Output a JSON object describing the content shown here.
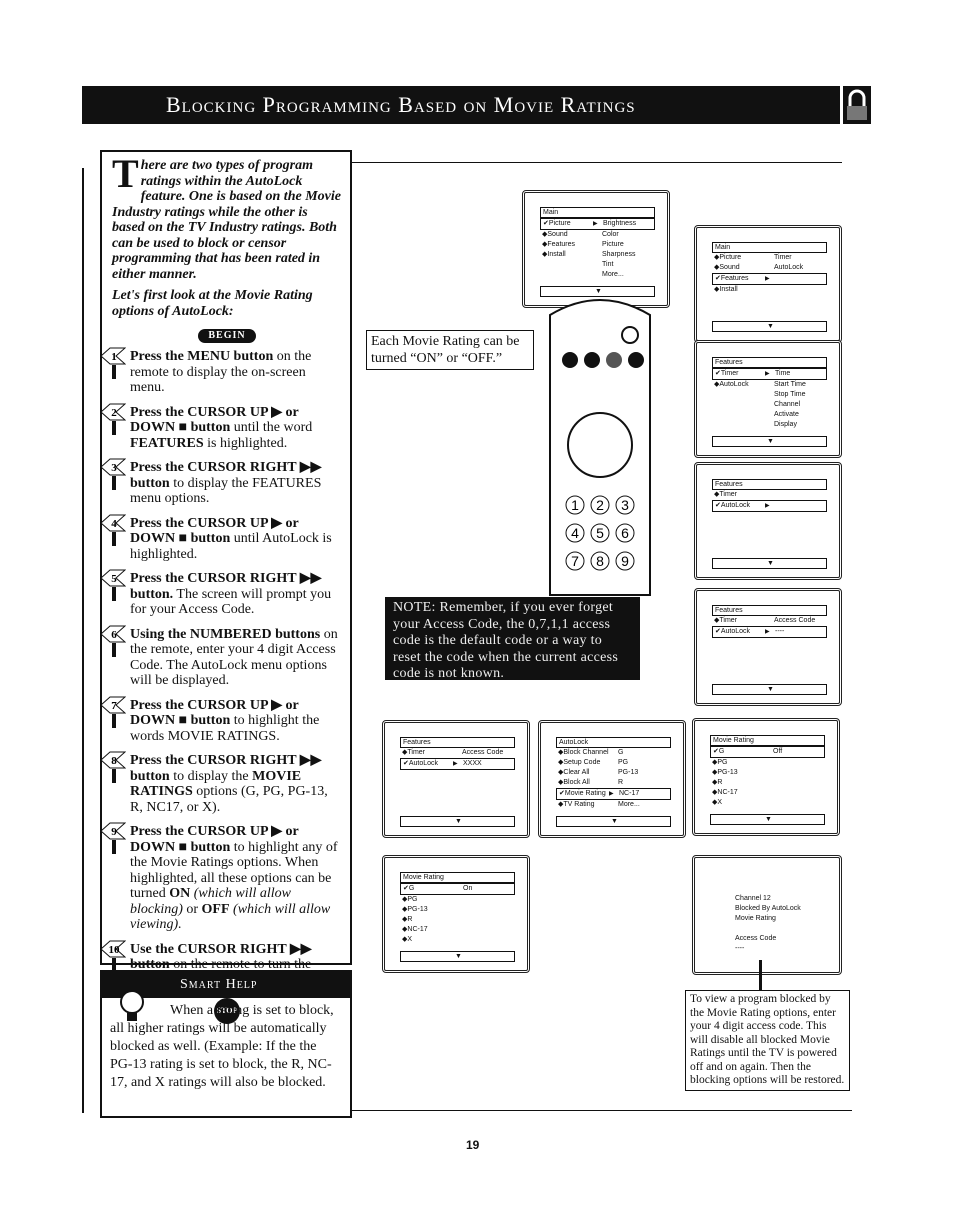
{
  "title": "Blocking Programming Based on Movie Ratings",
  "intro": {
    "dropcap": "T",
    "text": "here are two types of program ratings within the AutoLock feature. One is based on the Movie Industry ratings while the other is based on the TV Industry ratings. Both can be used to block or censor programming that has been rated in either manner.",
    "sub": "Let's first look at the Movie Rating options of AutoLock:"
  },
  "begin_label": "BEGIN",
  "steps": [
    {
      "n": "1",
      "parts": [
        {
          "b": "Press the MENU button"
        },
        {
          "t": " on the remote to display the on-screen menu."
        }
      ]
    },
    {
      "n": "2",
      "parts": [
        {
          "b": "Press the CURSOR UP ▶ or DOWN ■ button"
        },
        {
          "t": " until the word "
        },
        {
          "b": "FEATURES"
        },
        {
          "t": " is highlighted."
        }
      ]
    },
    {
      "n": "3",
      "parts": [
        {
          "b": "Press the CURSOR RIGHT ▶▶ button"
        },
        {
          "t": " to display the FEATURES menu options."
        }
      ]
    },
    {
      "n": "4",
      "parts": [
        {
          "b": "Press the CURSOR UP ▶ or DOWN ■ button"
        },
        {
          "t": " until AutoLock is highlighted."
        }
      ]
    },
    {
      "n": "5",
      "parts": [
        {
          "b": "Press the CURSOR RIGHT ▶▶ button."
        },
        {
          "t": " The screen will prompt you for your Access Code."
        }
      ]
    },
    {
      "n": "6",
      "parts": [
        {
          "b": "Using the NUMBERED buttons"
        },
        {
          "t": " on the remote, enter your 4 digit Access Code. The AutoLock menu options will be displayed."
        }
      ]
    },
    {
      "n": "7",
      "parts": [
        {
          "b": "Press the CURSOR UP ▶ or DOWN ■ button"
        },
        {
          "t": " to highlight the words MOVIE RATINGS."
        }
      ]
    },
    {
      "n": "8",
      "parts": [
        {
          "b": "Press the CURSOR RIGHT ▶▶ button"
        },
        {
          "t": " to display the "
        },
        {
          "b": "MOVIE RATINGS"
        },
        {
          "t": " options (G, PG, PG-13, R, NC17, or X)."
        }
      ]
    },
    {
      "n": "9",
      "parts": [
        {
          "b": "Press the CURSOR UP ▶ or DOWN ■ button"
        },
        {
          "t": " to highlight any of the Movie Ratings options. When highlighted, all these options can be turned "
        },
        {
          "b": "ON"
        },
        {
          "i": " (which will allow blocking)"
        },
        {
          "t": " or "
        },
        {
          "b": "OFF"
        },
        {
          "i": " (which will allow viewing)."
        }
      ]
    },
    {
      "n": "10",
      "parts": [
        {
          "b": "Use the CURSOR RIGHT ▶▶ button"
        },
        {
          "t": " on the remote to turn the rating option ON or OFF."
        }
      ]
    }
  ],
  "stop_label": "STOP",
  "smart_help": {
    "title": "Smart Help",
    "text": "When a rating is set to block, all higher ratings will be automatically blocked as well. (Example: If the the PG-13 rating is set to block, the R, NC-17, and X ratings will also be blocked."
  },
  "callout_rating": "Each Movie Rating can be turned “ON” or “OFF.”",
  "note": "NOTE: Remember, if you ever forget your Access Code, the 0,7,1,1 access code is the default code or a way to reset the code when the current access code is not known.",
  "callout_blocked": "To view a program blocked by the Movie Rating options, enter your 4 digit access code. This will disable all blocked Movie Ratings until the TV is powered off and on again. Then the blocking options will be restored.",
  "page_number": "19",
  "screens": [
    {
      "header": "Main",
      "rows": [
        {
          "l": "✔Picture",
          "r": "Brightness",
          "sel": true,
          "arrow": true
        },
        {
          "l": "◆Sound",
          "r": "Color"
        },
        {
          "l": "◆Features",
          "r": "Picture"
        },
        {
          "l": "◆Install",
          "r": "Sharpness"
        },
        {
          "l": "",
          "r": "Tint"
        },
        {
          "l": "",
          "r": "More..."
        }
      ]
    },
    {
      "header": "Main",
      "rows": [
        {
          "l": "◆Picture",
          "r": "Timer"
        },
        {
          "l": "◆Sound",
          "r": "AutoLock"
        },
        {
          "l": "✔Features",
          "sel": true,
          "arrow": true
        },
        {
          "l": "◆Install"
        }
      ]
    },
    {
      "header": "Features",
      "rows": [
        {
          "l": "✔Timer",
          "r": "Time",
          "sel": true,
          "arrow": true
        },
        {
          "l": "◆AutoLock",
          "r": "Start Time"
        },
        {
          "l": "",
          "r": "Stop Time"
        },
        {
          "l": "",
          "r": "Channel"
        },
        {
          "l": "",
          "r": "Activate"
        },
        {
          "l": "",
          "r": "Display"
        }
      ]
    },
    {
      "header": "Features",
      "rows": [
        {
          "l": "◆Timer"
        },
        {
          "l": "✔AutoLock",
          "sel": true,
          "arrow": true
        }
      ]
    },
    {
      "header": "Features",
      "rows": [
        {
          "l": "◆Timer",
          "r": "Access Code"
        },
        {
          "l": "✔AutoLock",
          "r": "----",
          "sel": true,
          "arrow": true
        }
      ]
    },
    {
      "header": "Features",
      "rows": [
        {
          "l": "◆Timer",
          "r": "Access Code"
        },
        {
          "l": "✔AutoLock",
          "r": "XXXX",
          "sel": true,
          "arrow": true
        }
      ]
    },
    {
      "header": "AutoLock",
      "rows": [
        {
          "l": "◆Block Channel",
          "r": "G"
        },
        {
          "l": "◆Setup Code",
          "r": "PG"
        },
        {
          "l": "◆Clear All",
          "r": "PG-13"
        },
        {
          "l": "◆Block All",
          "r": "R"
        },
        {
          "l": "✔Movie Rating",
          "r": "NC-17",
          "sel": true,
          "arrow": true
        },
        {
          "l": "◆TV Rating",
          "r": "More..."
        }
      ]
    },
    {
      "header": "Movie Rating",
      "rows": [
        {
          "l": "✔G",
          "r": "Off",
          "sel": true
        },
        {
          "l": "◆PG"
        },
        {
          "l": "◆PG-13"
        },
        {
          "l": "◆R"
        },
        {
          "l": "◆NC-17"
        },
        {
          "l": "◆X"
        }
      ]
    },
    {
      "header": "Movie Rating",
      "rows": [
        {
          "l": "✔G",
          "r": "On",
          "sel": true
        },
        {
          "l": "◆PG"
        },
        {
          "l": "◆PG-13"
        },
        {
          "l": "◆R"
        },
        {
          "l": "◆NC-17"
        },
        {
          "l": "◆X"
        }
      ]
    }
  ],
  "blocked_screen": {
    "lines": [
      "Channel 12",
      "Blocked By AutoLock",
      "Movie Rating",
      "",
      "Access Code",
      "----"
    ]
  },
  "remote_digits": [
    "1",
    "2",
    "3",
    "4",
    "5",
    "6",
    "7",
    "8",
    "9"
  ],
  "colors": {
    "ink": "#111111",
    "paper": "#ffffff"
  }
}
